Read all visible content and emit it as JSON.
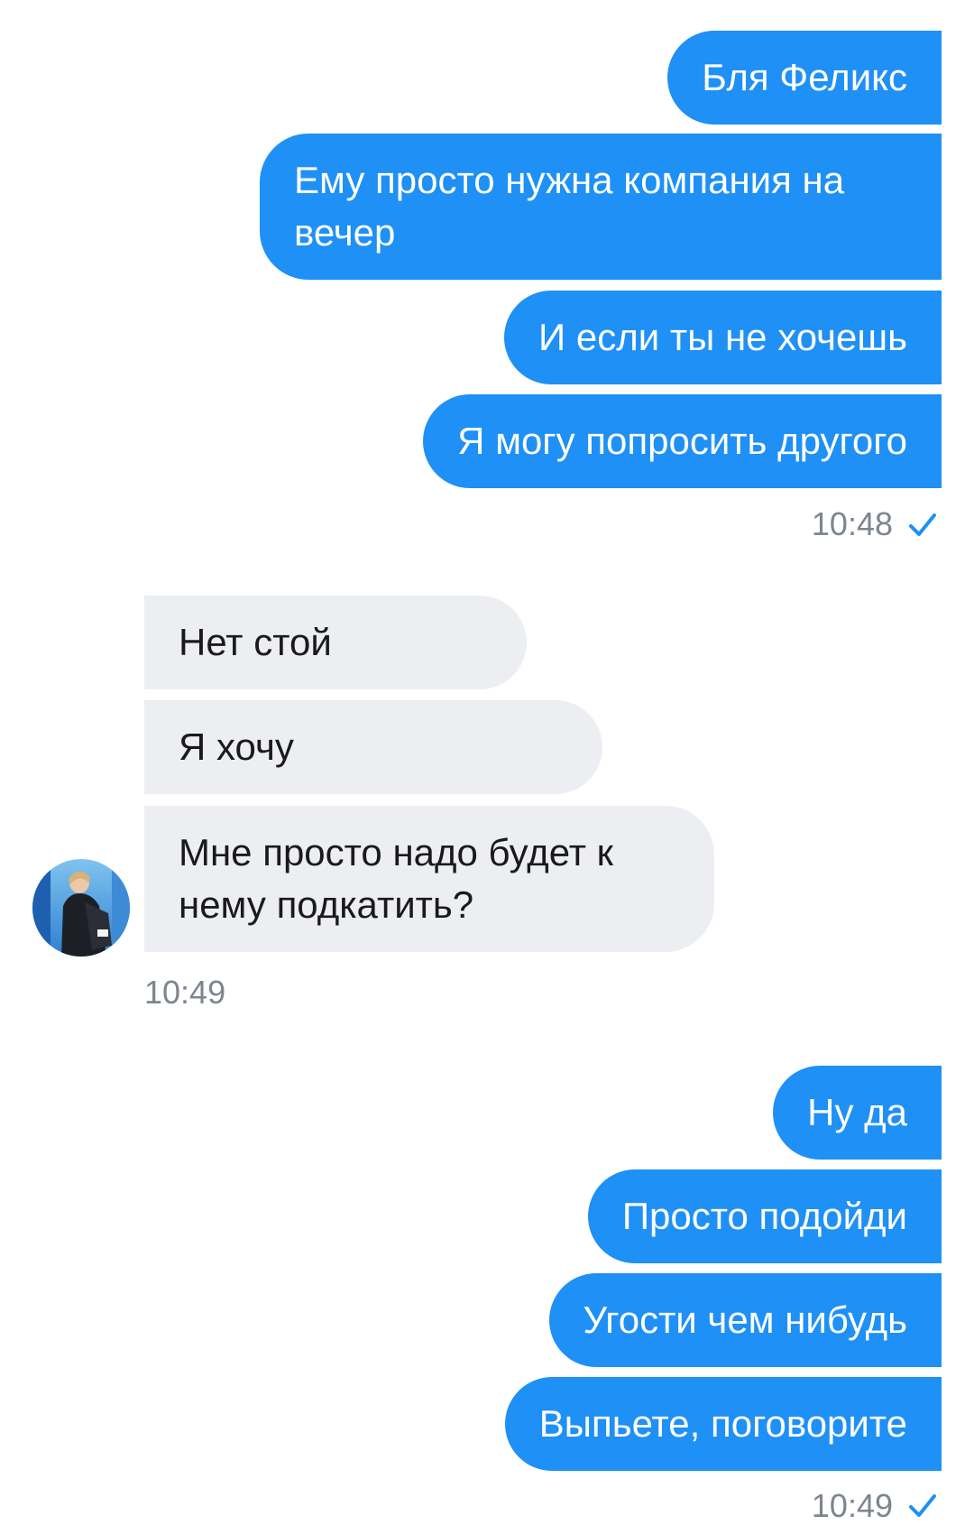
{
  "colors": {
    "outgoing_bubble": "#1e90f6",
    "incoming_bubble": "#eceef2",
    "timestamp": "#7d8590",
    "check": "#1e90f6"
  },
  "group1": {
    "messages": [
      "Бля Феликс",
      "Ему просто нужна компания на вечер",
      "И если ты не хочешь",
      "Я могу попросить другого"
    ],
    "time": "10:48",
    "status_icon": "single-check-icon"
  },
  "group2": {
    "messages": [
      "Нет стой",
      "Я хочу",
      "Мне просто надо будет к нему подкатить?"
    ],
    "time": "10:49",
    "avatar_icon": "contact-avatar"
  },
  "group3": {
    "messages": [
      "Ну да",
      "Просто подойди",
      "Угости чем нибудь",
      "Выпьете, поговорите"
    ],
    "time": "10:49",
    "status_icon": "single-check-icon"
  }
}
